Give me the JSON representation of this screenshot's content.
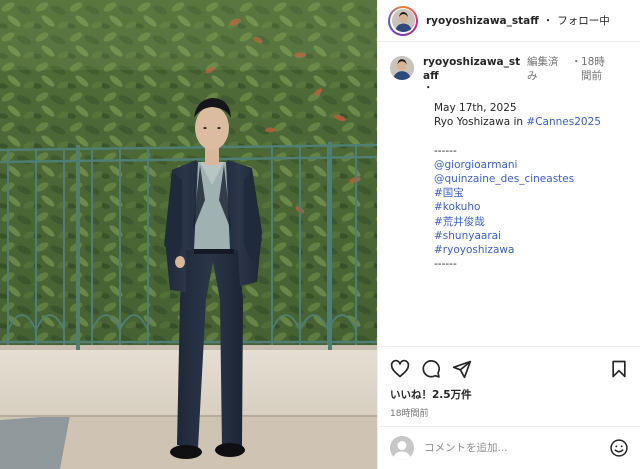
{
  "header": {
    "username": "ryoyoshizawa_staff",
    "separator": "・",
    "follow_status": "フォロー中"
  },
  "caption": {
    "username": "ryoyoshizawa_staff",
    "edited": "編集済み",
    "separator": "・",
    "time": "18時間前",
    "trailing_dot": "・",
    "date": "May 17th, 2025",
    "text_prefix": "Ryo Yoshizawa in ",
    "hashtag_cannes": "#Cannes2025",
    "divider": "------",
    "tags": [
      "@giorgioarmani",
      "@quinzaine_des_cineastes",
      "#国宝",
      "#kokuho",
      "#荒井俊哉",
      "#shunyaarai",
      "#ryoyoshizawa"
    ],
    "divider_end": "------"
  },
  "actions": {
    "likes": "いいね！2.5万件",
    "timestamp": "18時間前",
    "icons": [
      "heart-icon",
      "comment-icon",
      "share-icon",
      "bookmark-icon"
    ]
  },
  "comment_box": {
    "placeholder": "コメントを追加...",
    "icon": "emoji-icon"
  },
  "colors": {
    "link": "#3b5fc6",
    "muted": "#737373",
    "text": "#262626",
    "ring_start": "#f58529",
    "ring_end": "#515bd4"
  }
}
